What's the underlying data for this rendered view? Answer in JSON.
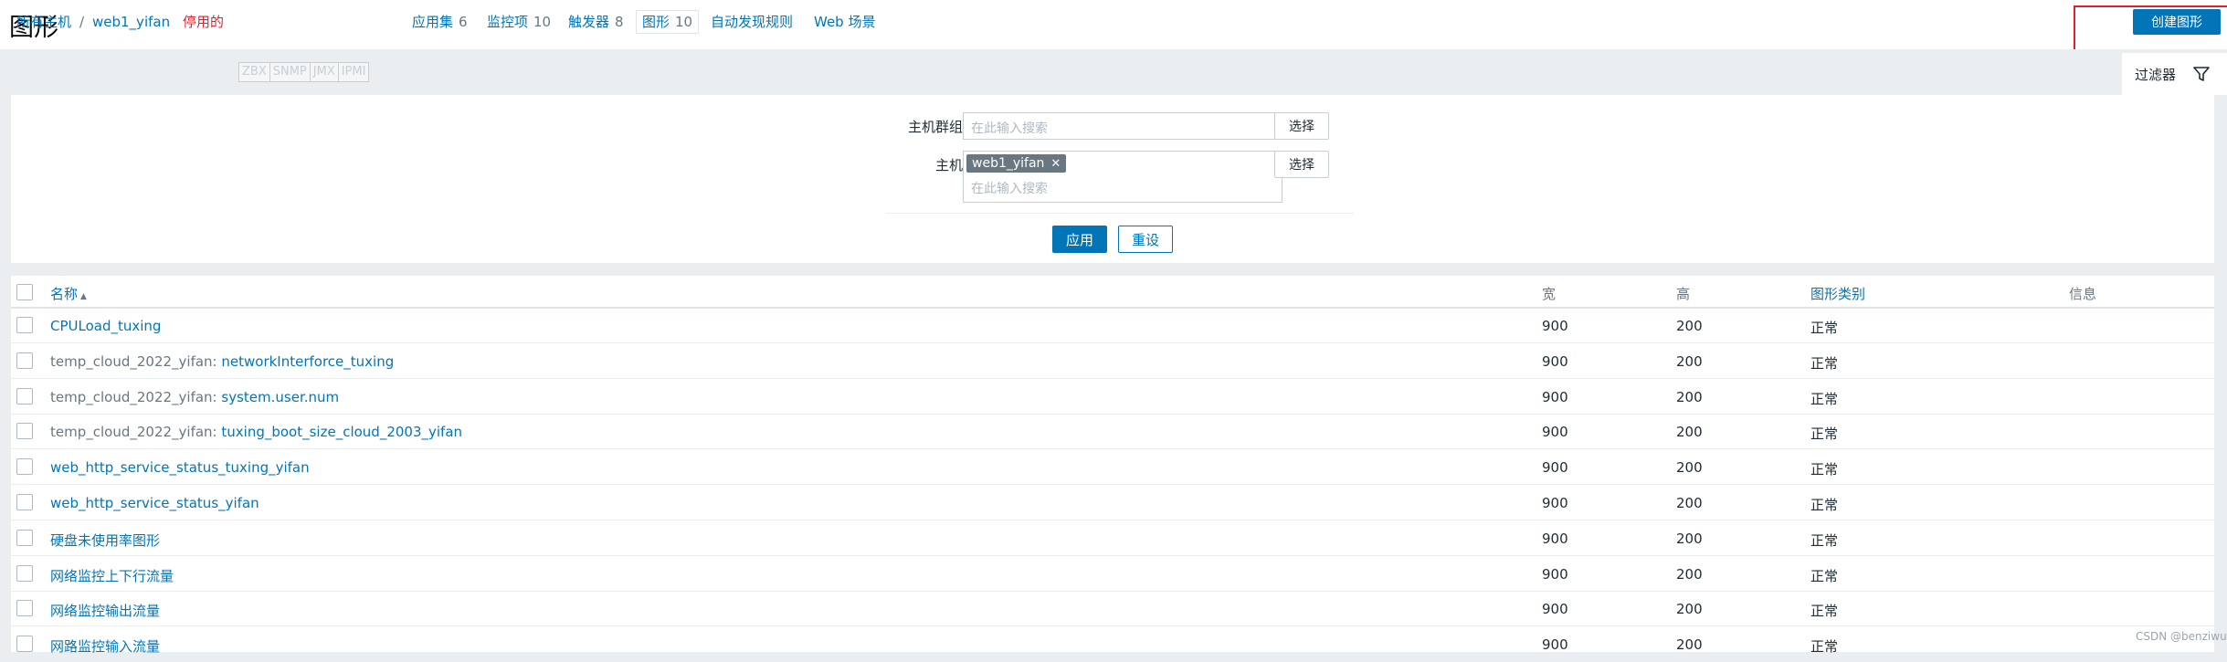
{
  "page": {
    "title": "图形",
    "create_button": "创建图形"
  },
  "nav": {
    "all_hosts": "所有主机",
    "separator": "/",
    "host": "web1_yifan",
    "status": "停用的",
    "availability": [
      "ZBX",
      "SNMP",
      "JMX",
      "IPMI"
    ],
    "links": [
      {
        "label": "应用集",
        "count": "6"
      },
      {
        "label": "监控项",
        "count": "10"
      },
      {
        "label": "触发器",
        "count": "8"
      },
      {
        "label": "图形",
        "count": "10"
      },
      {
        "label": "自动发现规则",
        "count": ""
      },
      {
        "label": "Web 场景",
        "count": ""
      }
    ]
  },
  "filter": {
    "tab_label": "过滤器",
    "host_group_label": "主机群组",
    "host_group_placeholder": "在此输入搜索",
    "host_label": "主机",
    "host_chip": "web1_yifan",
    "host_placeholder": "在此输入搜索",
    "select_label": "选择",
    "apply_label": "应用",
    "reset_label": "重设"
  },
  "table": {
    "columns": {
      "name": "名称",
      "width": "宽",
      "height": "高",
      "graph_type": "图形类别",
      "info": "信息"
    },
    "rows": [
      {
        "prefix": "",
        "name": "CPULoad_tuxing",
        "width": "900",
        "height": "200",
        "type": "正常"
      },
      {
        "prefix": "temp_cloud_2022_yifan: ",
        "name": "networkInterforce_tuxing",
        "width": "900",
        "height": "200",
        "type": "正常"
      },
      {
        "prefix": "temp_cloud_2022_yifan: ",
        "name": "system.user.num",
        "width": "900",
        "height": "200",
        "type": "正常"
      },
      {
        "prefix": "temp_cloud_2022_yifan: ",
        "name": "tuxing_boot_size_cloud_2003_yifan",
        "width": "900",
        "height": "200",
        "type": "正常"
      },
      {
        "prefix": "",
        "name": "web_http_service_status_tuxing_yifan",
        "width": "900",
        "height": "200",
        "type": "正常"
      },
      {
        "prefix": "",
        "name": "web_http_service_status_yifan",
        "width": "900",
        "height": "200",
        "type": "正常"
      },
      {
        "prefix": "",
        "name": "硬盘未使用率图形",
        "width": "900",
        "height": "200",
        "type": "正常"
      },
      {
        "prefix": "",
        "name": "网络监控上下行流量",
        "width": "900",
        "height": "200",
        "type": "正常"
      },
      {
        "prefix": "",
        "name": "网络监控输出流量",
        "width": "900",
        "height": "200",
        "type": "正常"
      },
      {
        "prefix": "",
        "name": "网路监控输入流量",
        "width": "900",
        "height": "200",
        "type": "正常"
      }
    ]
  },
  "watermark": "CSDN @benziwu",
  "colors": {
    "accent": "#0275b8",
    "disabled": "#e0202a",
    "highlight_box": "#e0202a"
  }
}
